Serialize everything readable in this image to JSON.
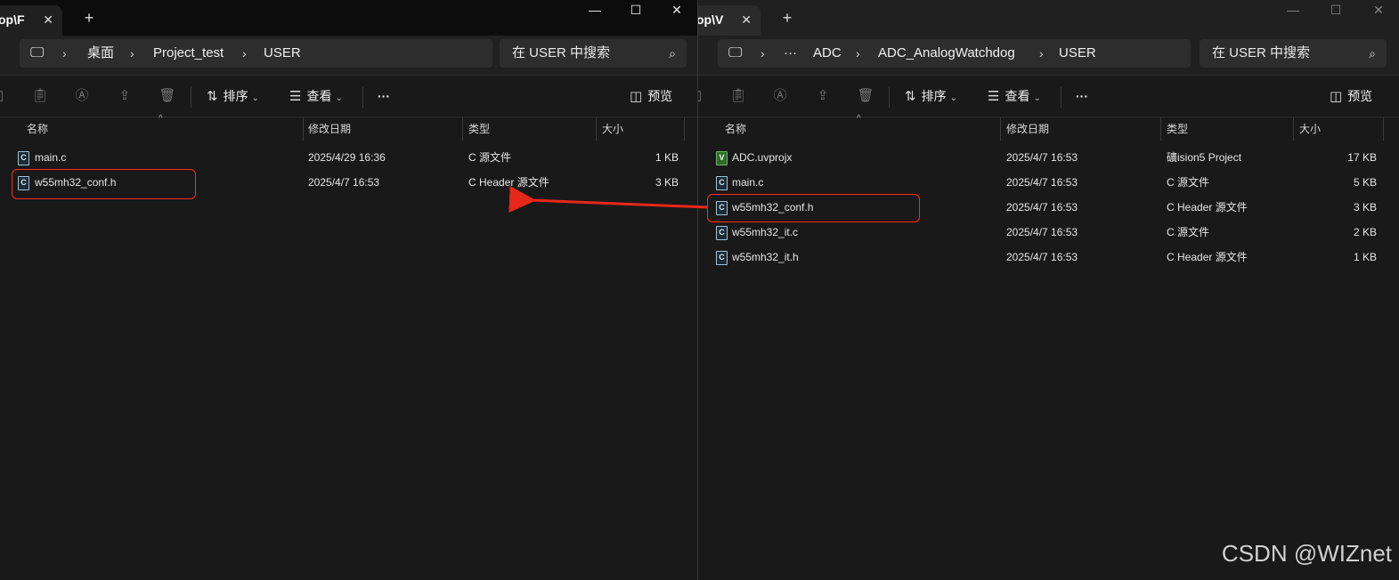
{
  "colors": {
    "highlight": "#ff2a1a",
    "arrow": "#e8271b",
    "background": "#191919"
  },
  "left": {
    "tab_title": "op\\F",
    "breadcrumb": [
      "桌面",
      "Project_test",
      "USER"
    ],
    "search_placeholder": "在 USER 中搜索",
    "toolbar": {
      "sort": "排序",
      "view": "查看",
      "more": "···",
      "preview": "预览"
    },
    "columns": {
      "name": "名称",
      "modified": "修改日期",
      "type": "类型",
      "size": "大小"
    },
    "files": [
      {
        "name": "main.c",
        "modified": "2025/4/29 16:36",
        "type": "C 源文件",
        "size": "1 KB",
        "icon": "c-file-icon"
      },
      {
        "name": "w55mh32_conf.h",
        "modified": "2025/4/7 16:53",
        "type": "C Header 源文件",
        "size": "3 KB",
        "icon": "c-file-icon"
      }
    ]
  },
  "right": {
    "tab_title": "op\\V",
    "breadcrumb": [
      "···",
      "ADC",
      "ADC_AnalogWatchdog",
      "USER"
    ],
    "search_placeholder": "在 USER 中搜索",
    "toolbar": {
      "sort": "排序",
      "view": "查看",
      "more": "···",
      "preview": "预览"
    },
    "columns": {
      "name": "名称",
      "modified": "修改日期",
      "type": "类型",
      "size": "大小"
    },
    "files": [
      {
        "name": "ADC.uvprojx",
        "modified": "2025/4/7 16:53",
        "type": "礦ision5 Project",
        "size": "17 KB",
        "icon": "uvision-file-icon"
      },
      {
        "name": "main.c",
        "modified": "2025/4/7 16:53",
        "type": "C 源文件",
        "size": "5 KB",
        "icon": "c-file-icon"
      },
      {
        "name": "w55mh32_conf.h",
        "modified": "2025/4/7 16:53",
        "type": "C Header 源文件",
        "size": "3 KB",
        "icon": "c-file-icon"
      },
      {
        "name": "w55mh32_it.c",
        "modified": "2025/4/7 16:53",
        "type": "C 源文件",
        "size": "2 KB",
        "icon": "c-file-icon"
      },
      {
        "name": "w55mh32_it.h",
        "modified": "2025/4/7 16:53",
        "type": "C Header 源文件",
        "size": "1 KB",
        "icon": "c-file-icon"
      }
    ]
  },
  "watermark": "CSDN @WIZnet"
}
